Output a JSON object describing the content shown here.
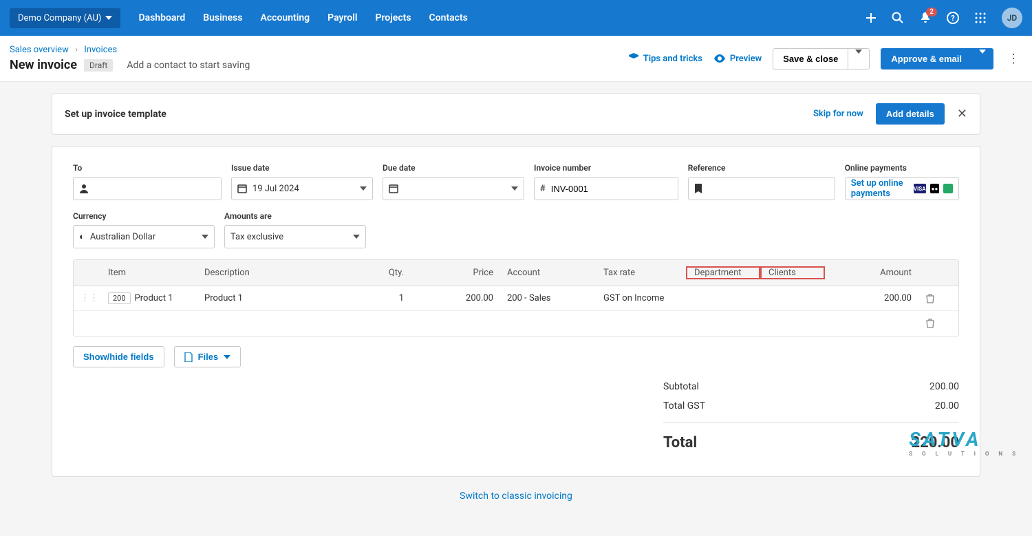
{
  "topnav": {
    "org": "Demo Company (AU)",
    "items": [
      "Dashboard",
      "Business",
      "Accounting",
      "Payroll",
      "Projects",
      "Contacts"
    ],
    "notif_count": "2",
    "avatar": "JD"
  },
  "breadcrumb": {
    "a": "Sales overview",
    "b": "Invoices"
  },
  "page": {
    "title": "New invoice",
    "status": "Draft",
    "hint": "Add a contact to start saving",
    "tips": "Tips and tricks",
    "preview": "Preview",
    "save": "Save & close",
    "approve": "Approve & email"
  },
  "banner": {
    "title": "Set up invoice template",
    "skip": "Skip for now",
    "add": "Add details"
  },
  "fields": {
    "to": "To",
    "issue": "Issue date",
    "issue_val": "19 Jul 2024",
    "due": "Due date",
    "invno": "Invoice number",
    "invno_val": "INV-0001",
    "ref": "Reference",
    "pay": "Online payments",
    "pay_link": "Set up online payments",
    "currency": "Currency",
    "currency_val": "Australian Dollar",
    "amounts": "Amounts are",
    "amounts_val": "Tax exclusive"
  },
  "table": {
    "headers": {
      "item": "Item",
      "desc": "Description",
      "qty": "Qty.",
      "price": "Price",
      "acct": "Account",
      "tax": "Tax rate",
      "dept": "Department",
      "cli": "Clients",
      "amt": "Amount"
    },
    "rows": [
      {
        "code": "200",
        "item": "Product 1",
        "desc": "Product 1",
        "qty": "1",
        "price": "200.00",
        "acct": "200 - Sales",
        "tax": "GST on Income",
        "dept": "",
        "cli": "",
        "amt": "200.00"
      }
    ]
  },
  "actions": {
    "showhide": "Show/hide fields",
    "files": "Files"
  },
  "totals": {
    "subtotal_l": "Subtotal",
    "subtotal_v": "200.00",
    "gst_l": "Total GST",
    "gst_v": "20.00",
    "total_l": "Total",
    "total_v": "220.00"
  },
  "footer": "Switch to classic invoicing",
  "watermark": {
    "brand": "SATVA",
    "tag": "S O L U T I O N S"
  }
}
